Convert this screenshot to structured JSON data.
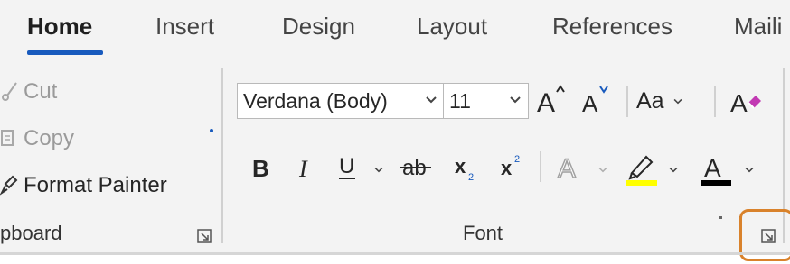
{
  "tabs": [
    {
      "label": "Home",
      "active": true
    },
    {
      "label": "Insert"
    },
    {
      "label": "Design"
    },
    {
      "label": "Layout"
    },
    {
      "label": "References"
    },
    {
      "label": "Maili"
    }
  ],
  "clipboard": {
    "cut_label": "Cut",
    "copy_label": "Copy",
    "format_painter_label": "Format Painter",
    "group_label": "pboard"
  },
  "font": {
    "font_name": "Verdana (Body)",
    "font_size": "11",
    "change_case_label": "Aa",
    "group_label": "Font",
    "highlight_color": "#ffff00",
    "font_color": "#000000"
  },
  "colors": {
    "accent": "#185abd",
    "callout": "#d9822b"
  }
}
